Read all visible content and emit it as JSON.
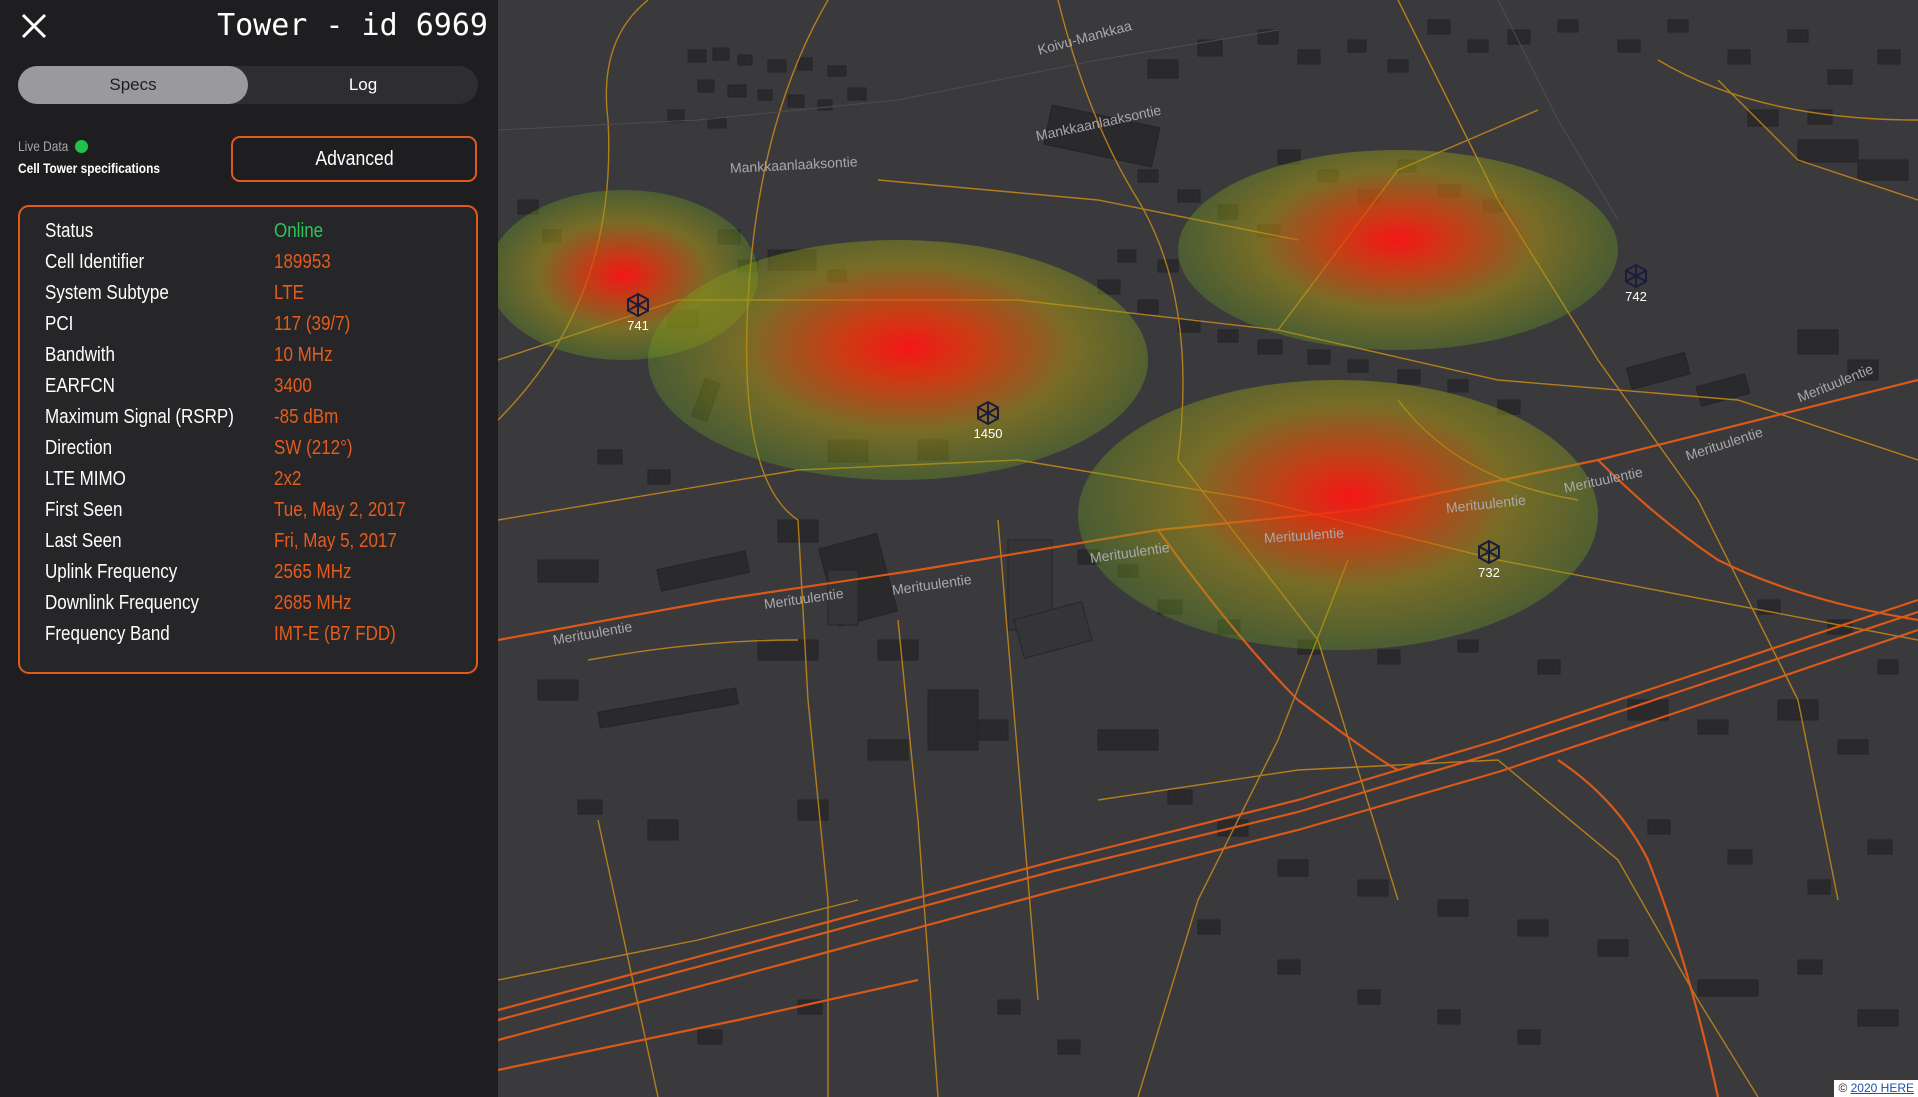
{
  "panel": {
    "title": "Tower - id 6969",
    "tabs": {
      "specs": "Specs",
      "log": "Log"
    },
    "live_label": "Live Data",
    "subtitle": "Cell Tower specifications",
    "advanced_button": "Advanced",
    "specs": [
      {
        "key": "Status",
        "value": "Online"
      },
      {
        "key": "Cell Identifier",
        "value": "189953"
      },
      {
        "key": "System Subtype",
        "value": "LTE"
      },
      {
        "key": "PCI",
        "value": "117 (39/7)"
      },
      {
        "key": "Bandwith",
        "value": "10 MHz"
      },
      {
        "key": "EARFCN",
        "value": "3400"
      },
      {
        "key": "Maximum Signal (RSRP)",
        "value": "-85 dBm"
      },
      {
        "key": "Direction",
        "value": "SW (212°)"
      },
      {
        "key": "LTE MIMO",
        "value": "2x2"
      },
      {
        "key": "First Seen",
        "value": "Tue, May 2, 2017"
      },
      {
        "key": "Last Seen",
        "value": "Fri, May 5, 2017"
      },
      {
        "key": "Uplink Frequency",
        "value": "2565 MHz"
      },
      {
        "key": "Downlink Frequency",
        "value": "2685 MHz"
      },
      {
        "key": "Frequency Band",
        "value": "IMT-E (B7 FDD)"
      }
    ]
  },
  "map": {
    "towers": {
      "t741": "741",
      "t1450": "1450",
      "t742": "742",
      "t732": "732"
    },
    "streets": {
      "koivu": "Koivu-Mankkaa",
      "mankkaanlaaksontie_1": "Mankkaanlaaksontie",
      "mankkaanlaaksontie_2": "Mankkaanlaaksontie",
      "merituulentie_1": "Merituulentie",
      "merituulentie_2": "Merituulentie",
      "merituulentie_3": "Merituulentie",
      "merituulentie_4": "Merituulentie",
      "merituulentie_5": "Merituulentie",
      "merituulentie_6": "Merituulentie",
      "merituulentie_7": "Merituulentie",
      "merituulentie_8": "Merituulentie",
      "merituulentie_9": "Merituulentie"
    },
    "attribution_prefix": "©",
    "attribution_link": "2020 HERE"
  },
  "colors": {
    "accent": "#e05a1c",
    "online": "#2ec55a",
    "panel_bg": "#1e1e20",
    "map_bg": "#3a3a3d"
  },
  "icons": [
    "close-icon",
    "live-status-dot",
    "cell-tower-icon"
  ]
}
